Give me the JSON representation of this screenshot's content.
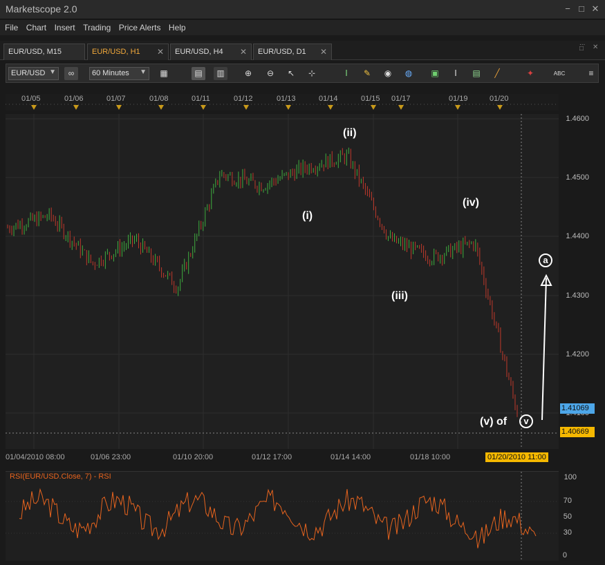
{
  "window": {
    "title": "Marketscope 2.0",
    "btn_min": "−",
    "btn_max": "□",
    "btn_close": "✕",
    "panel_dots": "...",
    "panel_max": "□",
    "panel_close": "✕"
  },
  "menu": [
    "File",
    "Chart",
    "Insert",
    "Trading",
    "Price Alerts",
    "Help"
  ],
  "tabs": [
    {
      "label": "EUR/USD, M15",
      "active": false
    },
    {
      "label": "EUR/USD, H1",
      "active": true
    },
    {
      "label": "EUR/USD, H4",
      "active": false
    },
    {
      "label": "EUR/USD, D1",
      "active": false
    }
  ],
  "toolbar": {
    "symbol": "EUR/USD",
    "timeframe": "60 Minutes",
    "text_tool": "ABC"
  },
  "date_markers": [
    "01/05",
    "01/06",
    "01/07",
    "01/08",
    "01/11",
    "01/12",
    "01/13",
    "01/14",
    "01/15",
    "01/17",
    "01/19",
    "01/20"
  ],
  "price_axis": [
    "1.4600",
    "1.4500",
    "1.4400",
    "1.4300",
    "1.4200",
    "1.4100"
  ],
  "time_axis": [
    "01/04/2010 08:00",
    "01/06 23:00",
    "01/10 20:00",
    "01/12 17:00",
    "01/14 14:00",
    "01/18 10:00"
  ],
  "time_cursor_label": "01/20/2010 11:00",
  "current_price": "1.41069",
  "cursor_price": "1.40669",
  "colors": {
    "up": "#3fae3f",
    "down": "#c0392b",
    "rsi": "#e8641e",
    "bg": "#202020",
    "current_price_bg": "#4da6e8",
    "cursor_price_bg": "#f5b800"
  },
  "wave_labels": {
    "i": "(i)",
    "ii": "(ii)",
    "iii": "(iii)",
    "iv": "(iv)",
    "v_of": "(v) of",
    "v_circle": "v",
    "a_circle": "a"
  },
  "rsi": {
    "title": "RSI(EUR/USD.Close, 7) - RSI",
    "axis": [
      "100",
      "70",
      "50",
      "30",
      "0"
    ]
  },
  "chart_data": {
    "type": "line",
    "title": "",
    "ylim": [
      1.405,
      1.461
    ],
    "x": [
      "01/04",
      "01/05",
      "01/06",
      "01/07",
      "01/08",
      "01/11",
      "01/12",
      "01/13",
      "01/14",
      "01/15",
      "01/18",
      "01/19",
      "01/20"
    ],
    "series": [
      {
        "values": [
          1.442,
          1.444,
          1.436,
          1.44,
          1.432,
          1.451,
          1.449,
          1.452,
          1.454,
          1.44,
          1.437,
          1.4395,
          1.411
        ]
      }
    ]
  }
}
